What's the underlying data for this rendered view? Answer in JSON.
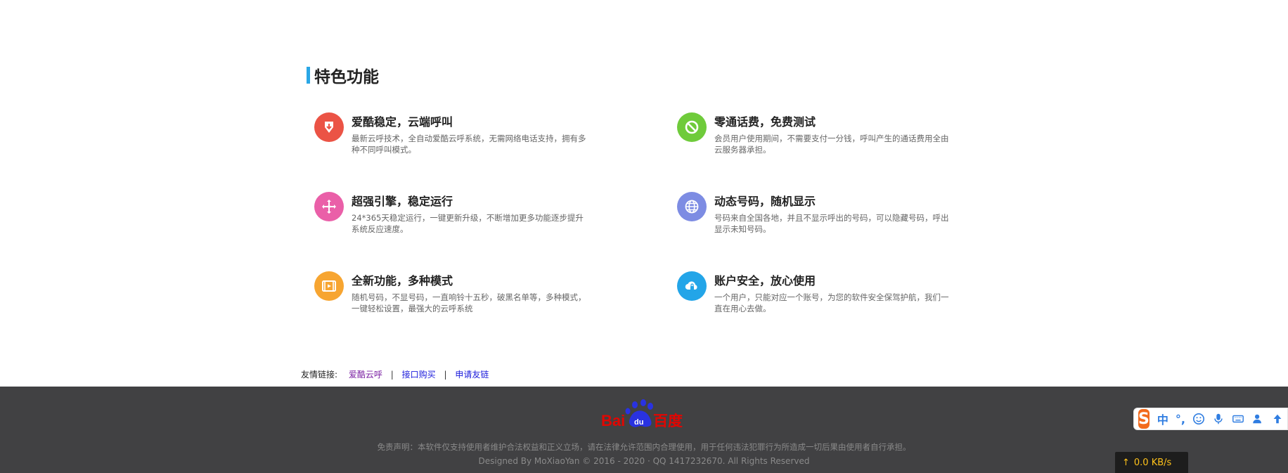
{
  "section": {
    "title": "特色功能",
    "accent_color": "#2aa7e6"
  },
  "features": [
    {
      "title": "爱酷稳定，云端呼叫",
      "desc": "最新云呼技术，全自动爱酷云呼系统，无需网络电话支持，拥有多种不同呼叫模式。",
      "icon": "shield-down-icon",
      "color": "#eb5345"
    },
    {
      "title": "零通话费，免费测试",
      "desc": "会员用户使用期间，不需要支付一分钱，呼叫产生的通话费用全由云服务器承担。",
      "icon": "ban-icon",
      "color": "#6fcb3b"
    },
    {
      "title": "超强引擎，稳定运行",
      "desc": "24*365天稳定运行，一键更新升级，不断增加更多功能逐步提升系统反应速度。",
      "icon": "move-arrows-icon",
      "color": "#ea5fa8"
    },
    {
      "title": "动态号码，随机显示",
      "desc": "号码来自全国各地，并且不显示呼出的号码，可以隐藏号码，呼出显示未知号码。",
      "icon": "globe-icon",
      "color": "#7d8ce3"
    },
    {
      "title": "全新功能，多种模式",
      "desc": "随机号码，不显号码，一直响铃十五秒，破黑名单等，多种模式，一键轻松设置，最强大的云呼系统",
      "icon": "film-icon",
      "color": "#f7a531"
    },
    {
      "title": "账户安全，放心使用",
      "desc": "一个用户，只能对应一个账号，为您的软件安全保驾护航，我们一直在用心去做。",
      "icon": "cloud-lock-icon",
      "color": "#23a5e8"
    }
  ],
  "friend_links": {
    "label": "友情链接:",
    "links": [
      "爱酷云呼",
      "接口购买",
      "申请友链"
    ],
    "separator": "|"
  },
  "footer": {
    "logo_text_left": "Bai",
    "logo_text_mid": "du",
    "logo_text_right": "百度",
    "disclaimer": "免责声明：本软件仅支持使用者维护合法权益和正义立场，请在法律允许范围内合理使用，用于任何违法犯罪行为所造成一切后果由使用者自行承担。",
    "credits": "Designed By MoXiaoYan © 2016 - 2020 · QQ 1417232670. All Rights Reserved"
  },
  "net_speed": {
    "value": "0.0 KB/s"
  },
  "ime": {
    "mode_label": "中",
    "punct_label": "°,"
  }
}
